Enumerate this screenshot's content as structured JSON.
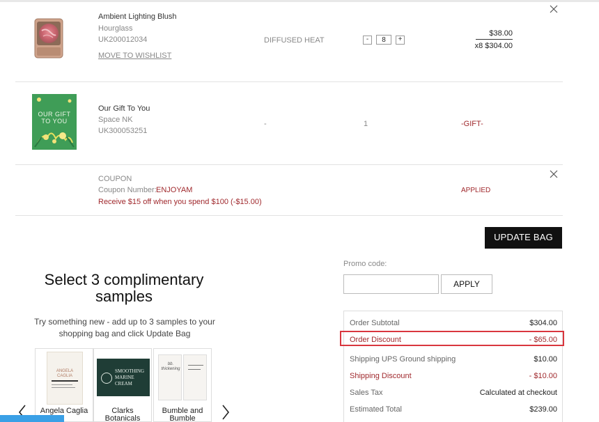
{
  "cart": {
    "items": [
      {
        "name": "Ambient Lighting Blush",
        "brand": "Hourglass",
        "sku": "UK200012034",
        "wishlist_label": "MOVE TO WISHLIST",
        "variant": "DIFFUSED HEAT",
        "qty": "8",
        "qty_minus": "-",
        "qty_plus": "+",
        "unit_price": "$38.00",
        "line_total": "x8 $304.00"
      },
      {
        "name": "Our Gift To You",
        "brand": "Space NK",
        "sku": "UK300053251",
        "variant": "-",
        "qty": "1",
        "price": "-GIFT-",
        "thumb_text": "OUR GIFT TO YOU"
      }
    ],
    "coupon": {
      "title": "COUPON",
      "number_label": "Coupon Number:",
      "code": "ENJOYAM",
      "description": "Receive $15 off when you spend $100 (-$15.00)",
      "status": "APPLIED"
    },
    "update_label": "UPDATE BAG"
  },
  "promo": {
    "label": "Promo code:",
    "value": "",
    "apply_label": "APPLY"
  },
  "summary": {
    "rows": [
      {
        "label": "Order Subtotal",
        "value": "$304.00"
      },
      {
        "label": "Order Discount",
        "value": "- $65.00"
      },
      {
        "label": "Shipping UPS Ground shipping",
        "value": "$10.00"
      },
      {
        "label": "Shipping Discount",
        "value": "- $10.00"
      },
      {
        "label": "Sales Tax",
        "value": "Calculated at checkout"
      },
      {
        "label": "Estimated Total",
        "value": "$239.00"
      }
    ]
  },
  "samples": {
    "title": "Select 3 complimentary samples",
    "subtitle": "Try something new - add up to 3 samples to your shopping bag and click Update Bag",
    "cards": [
      {
        "label": "Angela Caglia",
        "thumb": "ANGELA CAGLIA"
      },
      {
        "label": "Clarks Botanicals",
        "thumb": "SMOOTHING MARINE CREAM"
      },
      {
        "label": "Bumble and Bumble",
        "thumb": "bb. thickening"
      }
    ]
  },
  "colors": {
    "accent_red": "#a0292d",
    "highlight_box": "#d9363e",
    "dark_button": "#111111"
  }
}
